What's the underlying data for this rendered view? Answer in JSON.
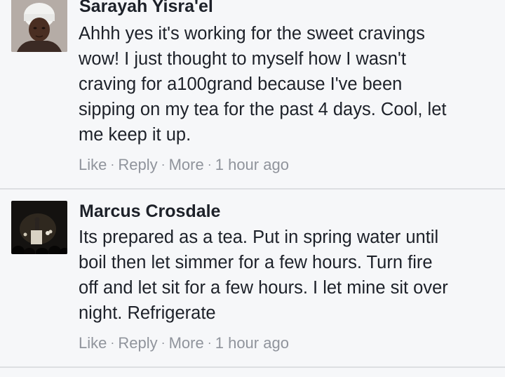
{
  "comments": [
    {
      "author": "Sarayah Yisra'el",
      "text": "Ahhh yes it's working for the sweet cravings\nwow! I just thought to myself how I wasn't\ncraving for a100grand because I've been\nsipping on my tea for the past 4 days. Cool, let\nme keep it up.",
      "actions": {
        "like": "Like",
        "reply": "Reply",
        "more": "More",
        "time": "1 hour ago"
      },
      "separator": "·"
    },
    {
      "author": "Marcus Crosdale",
      "text": "Its prepared as a tea. Put in spring water until\nboil then let simmer for a few hours. Turn fire\noff and let sit for a few hours. I let mine sit over\nnight. Refrigerate",
      "actions": {
        "like": "Like",
        "reply": "Reply",
        "more": "More",
        "time": "1 hour ago"
      },
      "separator": "·"
    }
  ],
  "colors": {
    "background": "#f6f7f9",
    "text": "#1d2129",
    "meta": "#90949c",
    "divider": "#dddfe2"
  }
}
